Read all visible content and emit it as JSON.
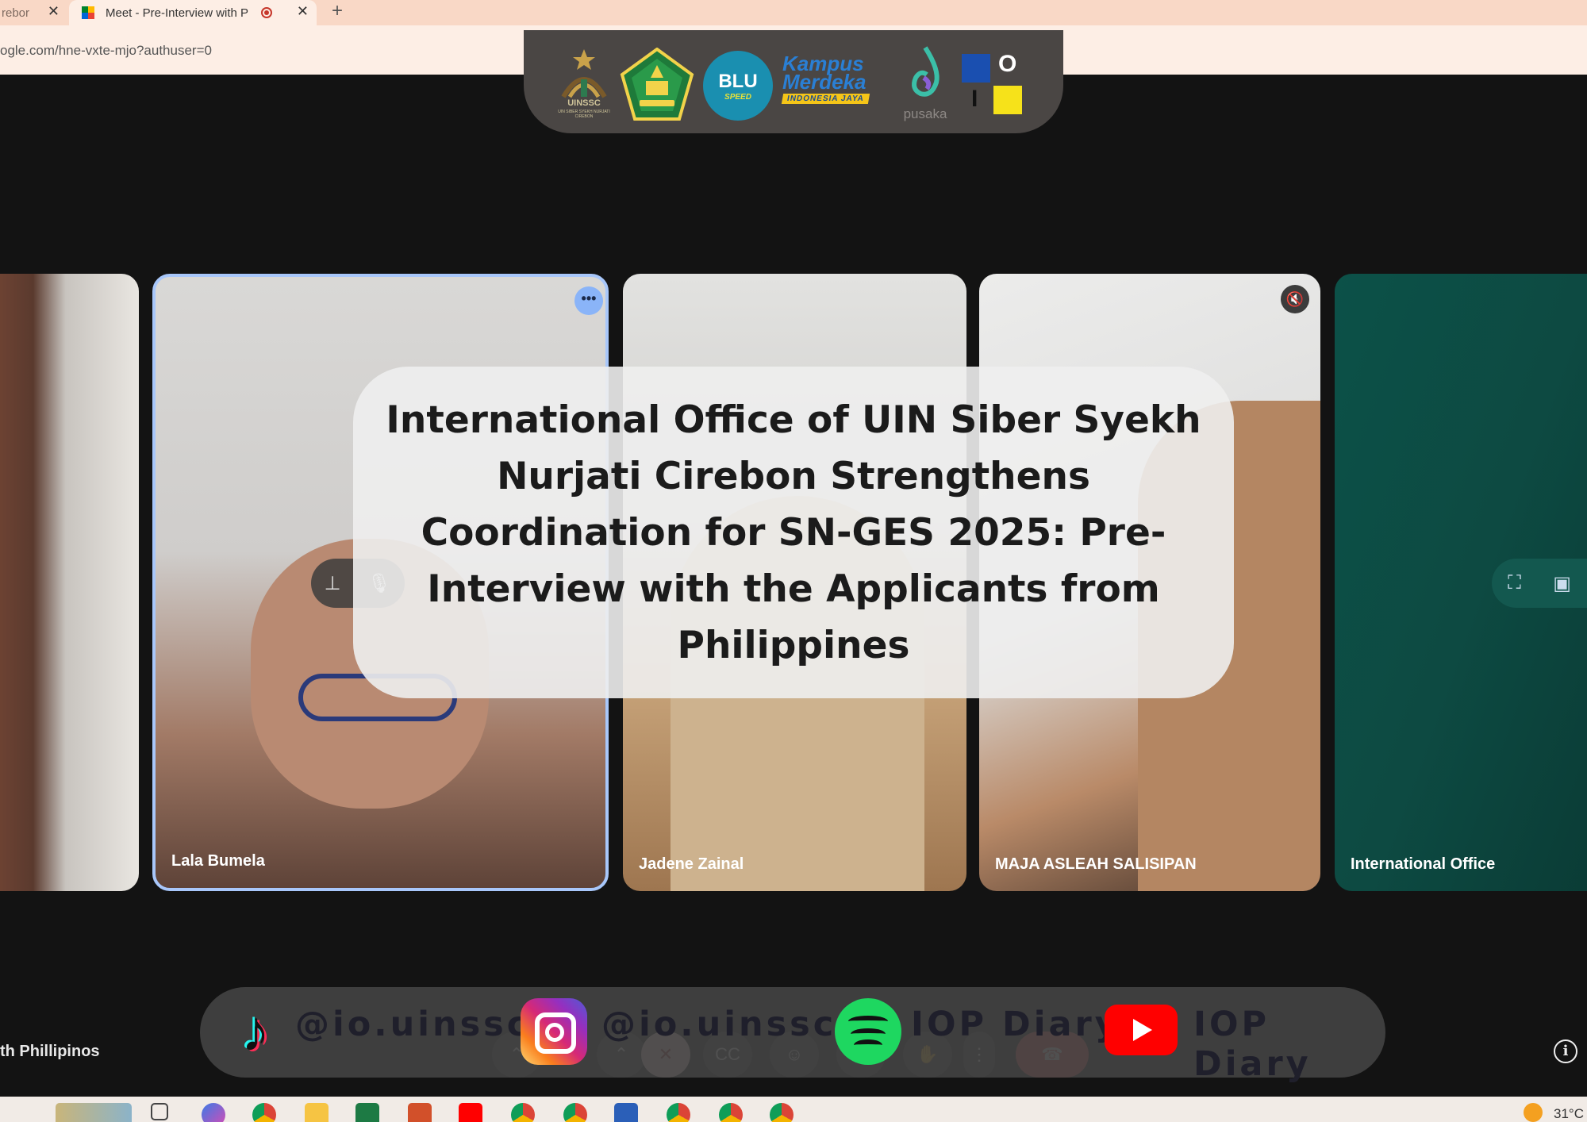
{
  "browser": {
    "tabs": [
      {
        "label": "rebor",
        "active": false
      },
      {
        "label": "Meet - Pre-Interview with P",
        "active": true
      }
    ],
    "url": "ogle.com/hne-vxte-mjo?authuser=0"
  },
  "logos": {
    "uinssc": "UINSSC",
    "uinssc_sub": "UIN SIBER SYEKH NURJATI CIREBON",
    "blu": "BLU",
    "blu_sub": "SPEED",
    "kampus_1": "Kampus",
    "kampus_2": "Merdeka",
    "kampus_3": "INDONESIA JAYA",
    "pusaka": "pusaka",
    "io_o": "O",
    "io_i": "I"
  },
  "participants": [
    {
      "name": ""
    },
    {
      "name": "Lala Bumela"
    },
    {
      "name": "Jadene Zainal"
    },
    {
      "name": "MAJA ASLEAH SALISIPAN"
    },
    {
      "name": "International Office"
    }
  ],
  "title": "International Office of UIN Siber Syekh Nurjati Cirebon Strengthens Coordination for SN-GES 2025: Pre-Interview with the Applicants from Philippines",
  "meeting_name": "th Phillipinos",
  "socials": [
    {
      "platform": "tiktok-icon",
      "handle": "@io.uinssc"
    },
    {
      "platform": "instagram-icon",
      "handle": "@io.uinssc"
    },
    {
      "platform": "spotify-icon",
      "handle": "IOP Diary"
    },
    {
      "platform": "youtube-icon",
      "handle": "IOP Diary"
    }
  ],
  "taskbar": {
    "weather": "31°C"
  },
  "colors": {
    "active_speaker_border": "#a8c7fa",
    "end_call": "#e2514a",
    "tabstrip": "#f9d8c6"
  }
}
